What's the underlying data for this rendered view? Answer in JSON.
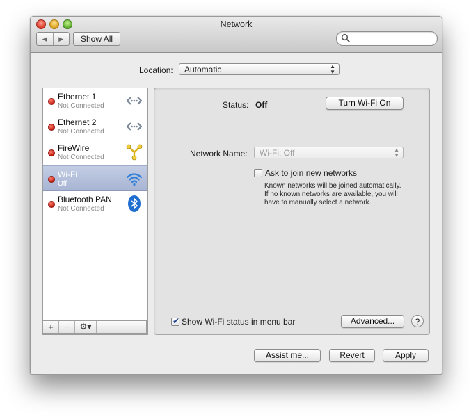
{
  "window": {
    "title": "Network",
    "nav_back": "◀",
    "nav_forward": "▶",
    "show_all_label": "Show All",
    "search_placeholder": ""
  },
  "location": {
    "label": "Location:",
    "value": "Automatic"
  },
  "services": [
    {
      "name": "Ethernet 1",
      "status": "Not Connected",
      "icon": "ethernet-icon",
      "selected": false
    },
    {
      "name": "Ethernet 2",
      "status": "Not Connected",
      "icon": "ethernet-icon",
      "selected": false
    },
    {
      "name": "FireWire",
      "status": "Not Connected",
      "icon": "firewire-icon",
      "selected": false
    },
    {
      "name": "Wi-Fi",
      "status": "Off",
      "icon": "wifi-icon",
      "selected": true
    },
    {
      "name": "Bluetooth PAN",
      "status": "Not Connected",
      "icon": "bluetooth-icon",
      "selected": false
    }
  ],
  "list_controls": {
    "add": "+",
    "remove": "−",
    "gear": "⚙▾"
  },
  "detail": {
    "status_label": "Status:",
    "status_value": "Off",
    "turn_on_label": "Turn Wi-Fi On",
    "network_name_label": "Network Name:",
    "network_name_value": "Wi-Fi: Off",
    "ask_join_label": "Ask to join new networks",
    "ask_join_checked": false,
    "ask_join_help": [
      "Known networks will be joined automatically.",
      "If no known networks are available, you will",
      "have to manually select a network."
    ],
    "show_status_label": "Show Wi-Fi status in menu bar",
    "show_status_checked": true,
    "advanced_label": "Advanced...",
    "help_label": "?"
  },
  "footer": {
    "assist_label": "Assist me...",
    "revert_label": "Revert",
    "apply_label": "Apply"
  },
  "colors": {
    "status_dot": "#c21a10",
    "selection": "#a7b4d3"
  }
}
